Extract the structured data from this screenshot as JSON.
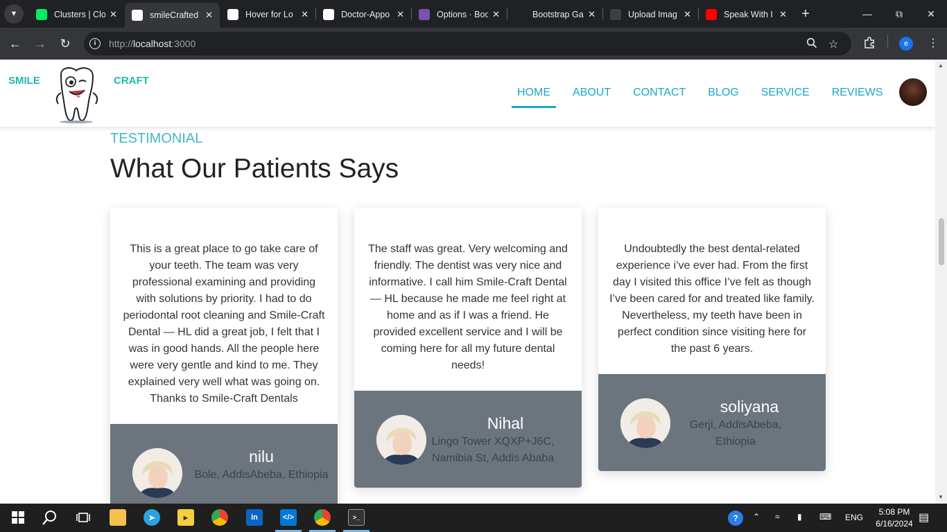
{
  "browser": {
    "tabs": [
      {
        "title": "Clusters | Clo",
        "icon": "mongodb-leaf-icon",
        "color": "#00ed64"
      },
      {
        "title": "smileCrafted",
        "icon": "github-icon",
        "color": "#ffffff",
        "active": true
      },
      {
        "title": "Hover for Lo",
        "icon": "openai-icon",
        "color": "#ffffff"
      },
      {
        "title": "Doctor-Appo",
        "icon": "github-icon",
        "color": "#ffffff"
      },
      {
        "title": "Options · Boo",
        "icon": "bootstrap-icon",
        "color": "#7952b3"
      },
      {
        "title": "Bootstrap Ga",
        "icon": "bg-icon",
        "color": "#202124"
      },
      {
        "title": "Upload Imag",
        "icon": "c-icon",
        "color": "#3c4043"
      },
      {
        "title": "Speak With I",
        "icon": "youtube-icon",
        "color": "#ff0000"
      }
    ],
    "url_prefix": "http://",
    "url_host": "localhost",
    "url_port": ":3000",
    "profile_initial": "e"
  },
  "site": {
    "brand_left": "SMILE",
    "brand_right": "CRAFT",
    "nav": [
      "HOME",
      "ABOUT",
      "CONTACT",
      "BLOG",
      "SERVICE",
      "REVIEWS"
    ],
    "active_nav": "HOME",
    "accent_color": "#19a6c6"
  },
  "section": {
    "label": "TESTIMONIAL",
    "title": "What Our Patients Says"
  },
  "testimonials": [
    {
      "text": "This is a great place to go take care of your teeth. The team was very professional examining and providing with solutions by priority. I had to do periodontal root cleaning and Smile-Craft Dental — HL did a great job, I felt that I was in good hands. All the people here were very gentle and kind to me. They explained very well what was going on. Thanks to Smile-Craft Dentals",
      "name": "nilu",
      "location": "Bole, AddisAbeba, Ethiopia"
    },
    {
      "text": "The staff was great. Very welcoming and friendly. The dentist was very nice and informative. I call him Smile-Craft Dental — HL because he made me feel right at home and as if I was a friend. He provided excellent service and I will be coming here for all my future dental needs!",
      "name": "Nihal",
      "location": "Lingo Tower XQXP+J6C, Namibia St, Addis Ababa"
    },
    {
      "text": "Undoubtedly the best dental-related experience i’ve ever had. From the first day I visited this office I’ve felt as though I’ve been cared for and treated like family. Nevertheless, my teeth have been in perfect condition since visiting here for the past 6 years.",
      "name": "soliyana",
      "location": "Gerji, AddisAbeba, Ethiopia"
    }
  ],
  "taskbar": {
    "language": "ENG",
    "time": "5:08 PM",
    "date": "6/16/2024"
  }
}
